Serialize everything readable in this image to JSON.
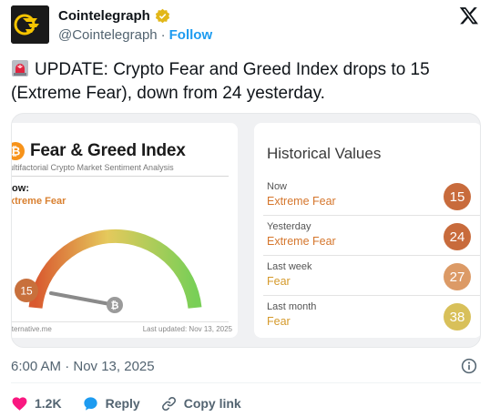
{
  "account": {
    "name": "Cointelegraph",
    "handle": "@Cointelegraph",
    "separator": "·",
    "follow_label": "Follow",
    "verified_icon": "gold-verified-badge-icon",
    "avatar_icon": "cointelegraph-logo-icon"
  },
  "platform": {
    "logo_icon": "x-logo-icon"
  },
  "tweet": {
    "emoji_icon": "rotating-light-siren-icon",
    "text": "UPDATE: Crypto Fear and Greed Index drops to 15 (Extreme Fear), down from 24 yesterday."
  },
  "media": {
    "left_card": {
      "title": "Fear & Greed Index",
      "subtitle": "ultifactorial Crypto Market Sentiment Analysis",
      "now_label": "low:",
      "now_value": "xtreme Fear",
      "gauge_value": "15",
      "footer_source": "lternative.me",
      "footer_updated": "Last updated: Nov 13, 2025",
      "colors": {
        "gauge_low": "#d9592f",
        "gauge_mid": "#e5c95c",
        "gauge_high": "#79cf57",
        "marker": "#c8703c",
        "now_value": "#d98030"
      }
    },
    "right_card": {
      "title": "Historical Values",
      "rows": [
        {
          "label": "Now",
          "value": "Extreme Fear",
          "score": "15",
          "value_color": "#d5762c",
          "circle_color": "#c86b3c"
        },
        {
          "label": "Yesterday",
          "value": "Extreme Fear",
          "score": "24",
          "value_color": "#d5762c",
          "circle_color": "#c86b3c"
        },
        {
          "label": "Last week",
          "value": "Fear",
          "score": "27",
          "value_color": "#d59a2c",
          "circle_color": "#dc9a66"
        },
        {
          "label": "Last month",
          "value": "Fear",
          "score": "38",
          "value_color": "#d59a2c",
          "circle_color": "#d8c05a"
        }
      ]
    }
  },
  "meta": {
    "timestamp": "6:00 AM · Nov 13, 2025",
    "info_icon": "info-circle-icon"
  },
  "actions": [
    {
      "label": "1.2K",
      "icon": "heart-icon",
      "color": "#f91880"
    },
    {
      "label": "Reply",
      "icon": "reply-bubble-icon",
      "color": "#1d9bf0"
    },
    {
      "label": "Copy link",
      "icon": "link-icon",
      "color": "#536471"
    }
  ]
}
